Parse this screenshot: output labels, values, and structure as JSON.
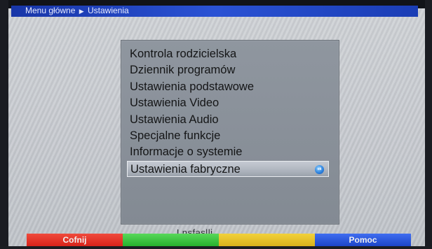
{
  "breadcrumb": {
    "root": "Menu główne",
    "separator": "▶",
    "current": "Ustawienia"
  },
  "menu": {
    "items": [
      {
        "label": "Kontrola rodzicielska"
      },
      {
        "label": "Dziennik programów"
      },
      {
        "label": "Ustawienia podstawowe"
      },
      {
        "label": "Ustawienia Video"
      },
      {
        "label": "Ustawienia Audio"
      },
      {
        "label": "Specjalne funkcje"
      },
      {
        "label": "Informacje o systemie"
      },
      {
        "label": "Ustawienia fabryczne",
        "selected": true
      }
    ],
    "selected_badge": "ok"
  },
  "status": {
    "partial_text": "Lnsfaslli"
  },
  "color_buttons": {
    "red_label": "Cofnij",
    "green_label": "",
    "yellow_label": "",
    "blue_label": "Pomoc"
  },
  "colors": {
    "breadcrumb_bg": "#1836a8",
    "panel_bg": "#8b929b",
    "red": "#d8231a",
    "green": "#27b02d",
    "yellow": "#d9b21c",
    "blue": "#1c45c8"
  }
}
